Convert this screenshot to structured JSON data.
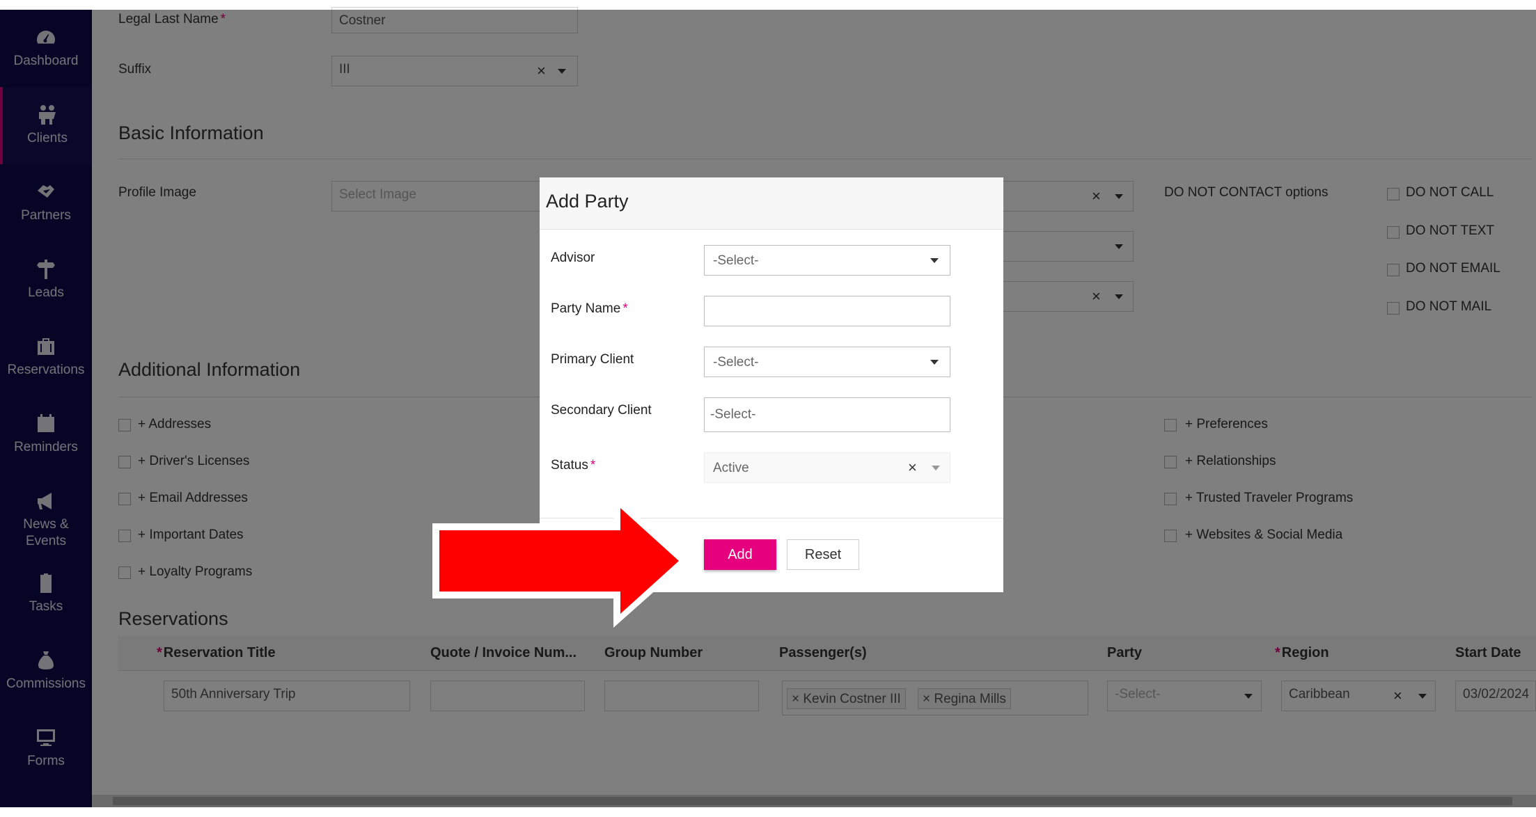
{
  "sidebar": {
    "items": [
      {
        "label": "Dashboard",
        "icon": "dashboard-icon"
      },
      {
        "label": "Clients",
        "icon": "clients-icon"
      },
      {
        "label": "Partners",
        "icon": "partners-icon"
      },
      {
        "label": "Leads",
        "icon": "leads-icon"
      },
      {
        "label": "Reservations",
        "icon": "reservations-icon"
      },
      {
        "label": "Reminders",
        "icon": "calendar-icon"
      },
      {
        "label": "News &\nEvents",
        "icon": "megaphone-icon"
      },
      {
        "label": "Tasks",
        "icon": "clipboard-icon"
      },
      {
        "label": "Commissions",
        "icon": "money-bag-icon"
      },
      {
        "label": "Forms",
        "icon": "monitor-icon"
      }
    ]
  },
  "form": {
    "legal_last_name_label": "Legal Last Name",
    "legal_last_name_value": "Costner",
    "suffix_label": "Suffix",
    "suffix_value": "III",
    "required_mark": "*"
  },
  "basic_info": {
    "title": "Basic Information",
    "profile_image_label": "Profile Image",
    "profile_image_placeholder": "Select Image",
    "dnc_label": "DO NOT CONTACT options",
    "dnc_options": [
      "DO NOT CALL",
      "DO NOT TEXT",
      "DO NOT EMAIL",
      "DO NOT MAIL"
    ]
  },
  "additional_info": {
    "title": "Additional Information",
    "left_options": [
      "+ Addresses",
      "+ Driver's Licenses",
      "+ Email Addresses",
      "+ Important Dates",
      "+ Loyalty Programs"
    ],
    "right_options": [
      "+ Preferences",
      "+ Relationships",
      "+ Trusted Traveler Programs",
      "+ Websites & Social Media"
    ]
  },
  "reservations": {
    "title": "Reservations",
    "columns": [
      "Reservation Title",
      "Quote / Invoice Num...",
      "Group Number",
      "Passenger(s)",
      "Party",
      "Region",
      "Start Date"
    ],
    "row": {
      "title": "50th Anniversary Trip",
      "passengers": [
        "Kevin Costner III",
        "Regina Mills"
      ],
      "party": "-Select-",
      "region": "Caribbean",
      "start_date": "03/02/2024"
    }
  },
  "modal": {
    "title": "Add Party",
    "advisor_label": "Advisor",
    "advisor_value": "-Select-",
    "party_name_label": "Party Name",
    "party_name_value": "",
    "primary_client_label": "Primary Client",
    "primary_client_value": "-Select-",
    "secondary_client_label": "Secondary Client",
    "secondary_client_value": "-Select-",
    "status_label": "Status",
    "status_value": "Active",
    "add_label": "Add",
    "reset_label": "Reset"
  },
  "colors": {
    "sidebar_bg": "#0f0a4d",
    "accent": "#e6007e",
    "arrow": "#ff0000"
  }
}
